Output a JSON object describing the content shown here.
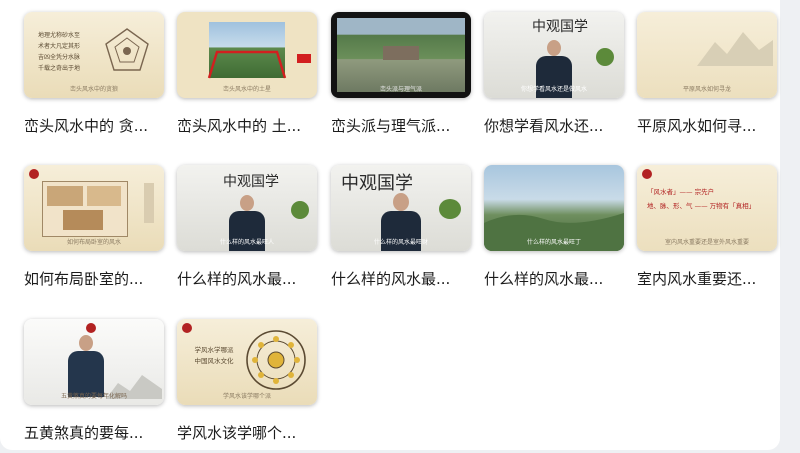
{
  "videos": [
    {
      "title": "峦头风水中的 贪...",
      "caption": "峦头风水中的贪狼",
      "lines": [
        "地理尤称砂水至",
        "术者大凡定其形",
        "吉凶全凭分水脉",
        "千载之奇出于地"
      ]
    },
    {
      "title": "峦头风水中的 土...",
      "caption": "峦头风水中的土星"
    },
    {
      "title": "峦头派与理气派...",
      "caption": "峦头派与理气派"
    },
    {
      "title": "你想学看风水还...",
      "caption": "你想学看风水还是做风水"
    },
    {
      "title": "平原风水如何寻...",
      "caption": "平原风水如何寻龙"
    },
    {
      "title": "如何布局卧室的...",
      "caption": "如何布局卧室的风水"
    },
    {
      "title": "什么样的风水最...",
      "caption": "什么样的风水最旺人"
    },
    {
      "title": "什么样的风水最...",
      "caption": "什么样的风水最旺财"
    },
    {
      "title": "什么样的风水最...",
      "caption": "什么样的风水最旺丁"
    },
    {
      "title": "室内风水重要还...",
      "caption": "室内风水重要还是室外风水重要",
      "lines": [
        "「风水者」—— 宗先户",
        "地、脉、形、气 —— 万物有「真相」"
      ]
    },
    {
      "title": "五黄煞真的要每...",
      "caption": "五黄煞真的要每年化解吗"
    },
    {
      "title": "学风水该学哪个...",
      "caption": "学风水该学哪个派",
      "lines": [
        "学风水学哪派",
        "中国风水文化"
      ]
    }
  ],
  "brand": {
    "calligraphy": "中观国学"
  },
  "colors": {
    "paper": "#f4e9cf",
    "ink": "#5b4a32",
    "seal": "#b22222"
  }
}
